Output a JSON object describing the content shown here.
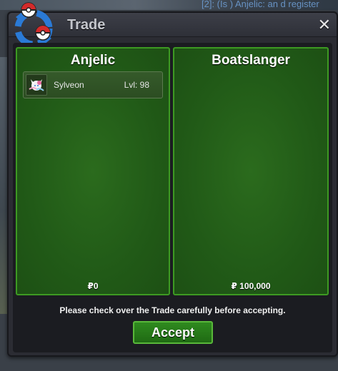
{
  "background": {
    "chat_text": "[2]: (Is ) Anjelic: an d register"
  },
  "window": {
    "title": "Trade",
    "close_symbol": "✕"
  },
  "left_panel": {
    "player": "Anjelic",
    "money": "₽0",
    "items": [
      {
        "name": "Sylveon",
        "level": "Lvl: 98"
      }
    ]
  },
  "right_panel": {
    "player": "Boatslanger",
    "money": "₽ 100,000",
    "items": []
  },
  "notice": "Please check over the Trade carefully before accepting.",
  "accept_label": "Accept",
  "colors": {
    "panel_green": "#215a17",
    "panel_border": "#3d9a22",
    "window_bg": "#2b2c33",
    "accept_green": "#2f8a1f"
  }
}
